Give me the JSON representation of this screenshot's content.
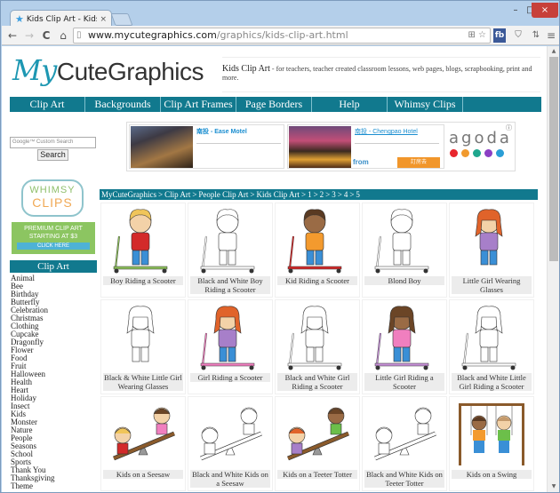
{
  "browser": {
    "tab_title": "Kids Clip Art - Kids Image",
    "tab_close": "×",
    "url_domain": "www.mycutegraphics.com",
    "url_path": "/graphics/kids-clip-art.html",
    "extensions": {
      "fb": "fb",
      "menu": "≡",
      "shield": "⛉",
      "translate": "⇅"
    },
    "window_controls": {
      "minimize": "–",
      "maximize": "□",
      "close": "×"
    }
  },
  "header": {
    "logo_my": "My",
    "logo_rest": "CuteGraphics",
    "tagline_title": "Kids Clip Art",
    "tagline_text": " - for teachers, teacher created classroom lessons, web pages, blogs, scrapbooking, print and more."
  },
  "nav": {
    "items": [
      {
        "label": "Clip Art"
      },
      {
        "label": "Backgrounds"
      },
      {
        "label": "Clip Art Frames"
      },
      {
        "label": "Page Borders"
      },
      {
        "label": "Help"
      },
      {
        "label": "Whimsy Clips"
      }
    ]
  },
  "search": {
    "placeholder": "Google™ Custom Search",
    "button": "Search"
  },
  "ad": {
    "cards": [
      {
        "title": "南投 - Ease Motel"
      },
      {
        "title": "南投 - Chengpao Hotel",
        "from": "from",
        "book": "訂房去"
      }
    ],
    "brand": "agoda",
    "brand_dot_colors": [
      "#e8262d",
      "#f19a2e",
      "#1fa78e",
      "#8b3fc4",
      "#2a9ed6"
    ],
    "info": "ⓘ"
  },
  "promo": {
    "badge_line1": "WHIMSY",
    "badge_line2": "CLIPS",
    "text_line1": "PREMIUM CLIP ART",
    "text_line2": "STARTING AT $3",
    "cta": "CLICK HERE"
  },
  "sidebar": {
    "heading": "Clip Art",
    "categories": [
      "Animal",
      "Bee",
      "Birthday",
      "Butterfly",
      "Celebration",
      "Christmas",
      "Clothing",
      "Cupcake",
      "Dragonfly",
      "Flower",
      "Food",
      "Fruit",
      "Halloween",
      "Health",
      "Heart",
      "Holiday",
      "Insect",
      "Kids",
      "Monster",
      "Nature",
      "People",
      "Seasons",
      "School",
      "Sports",
      "Thank You",
      "Thanksgiving",
      "Theme"
    ]
  },
  "breadcrumb": {
    "items": [
      "MyCuteGraphics",
      "Clip Art",
      "People Clip Art",
      "Kids Clip Art",
      "1",
      "2",
      "3",
      "4",
      "5"
    ],
    "separator": ">"
  },
  "gallery": {
    "items": [
      {
        "caption": "Boy Riding a Scooter",
        "style": "color",
        "icon": "boy-scooter"
      },
      {
        "caption": "Black and White Boy Riding a Scooter",
        "style": "bw",
        "icon": "boy-scooter"
      },
      {
        "caption": "Kid Riding a Scooter",
        "style": "color",
        "icon": "kid-scooter"
      },
      {
        "caption": "Blond Boy",
        "style": "bw",
        "icon": "boy-scooter"
      },
      {
        "caption": "Little Girl Wearing Glasses",
        "style": "color",
        "icon": "girl-glasses"
      },
      {
        "caption": "Black & White Little Girl Wearing Glasses",
        "style": "bw",
        "icon": "girl-glasses"
      },
      {
        "caption": "Girl Riding a Scooter",
        "style": "color",
        "icon": "girl-scooter"
      },
      {
        "caption": "Black and White Girl Riding a Scooter",
        "style": "bw",
        "icon": "girl-scooter"
      },
      {
        "caption": "Little Girl Riding a Scooter",
        "style": "color",
        "icon": "girl2-scooter"
      },
      {
        "caption": "Black and White Little Girl Riding a Scooter",
        "style": "bw",
        "icon": "girl2-scooter"
      },
      {
        "caption": "Kids on a Seesaw",
        "style": "color",
        "icon": "seesaw"
      },
      {
        "caption": "Black and White Kids on a Seesaw",
        "style": "bw",
        "icon": "seesaw"
      },
      {
        "caption": "Kids on a Teeter Totter",
        "style": "color",
        "icon": "teeter"
      },
      {
        "caption": "Black and White Kids on Teeter Totter",
        "style": "bw",
        "icon": "teeter"
      },
      {
        "caption": "Kids on a Swing",
        "style": "color",
        "icon": "swing"
      }
    ]
  },
  "colors": {
    "accent": "#11798e",
    "logo_accent": "#1d97b2",
    "ad_link": "#1b8ed0",
    "ad_button": "#f1962b",
    "promo_green": "#8cc561"
  }
}
